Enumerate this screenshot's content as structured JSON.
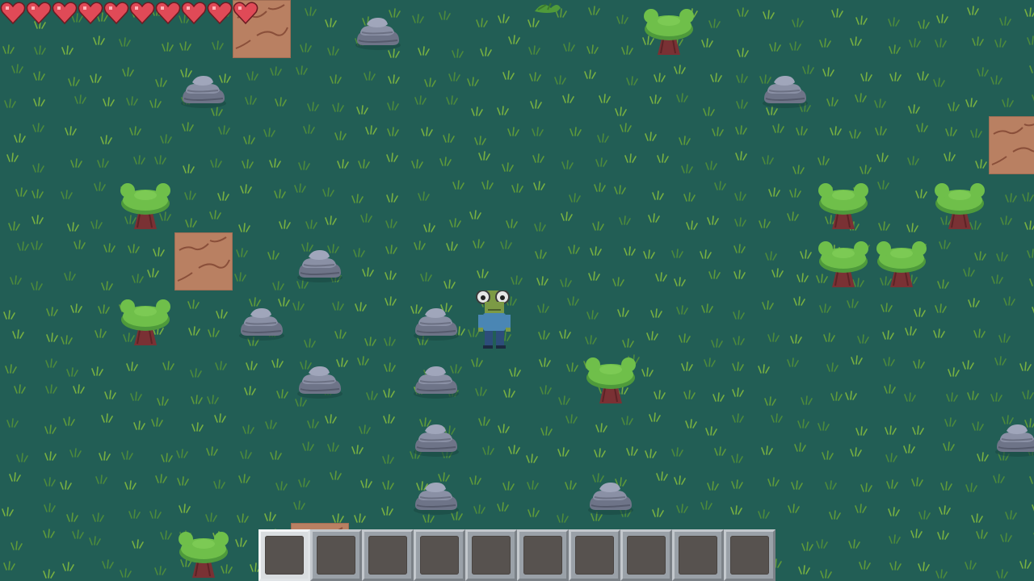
{
  "hud": {
    "health": {
      "current": 10,
      "max": 10
    },
    "hotbar": {
      "slot_count": 10,
      "selected_slot": 0,
      "items": [
        null,
        null,
        null,
        null,
        null,
        null,
        null,
        null,
        null,
        null
      ]
    }
  },
  "world": {
    "tile_size": 72,
    "background_color": "#225e55",
    "grass_blade_colors": [
      "#5f9a3a",
      "#78b041",
      "#4d8a3c"
    ]
  },
  "player": {
    "character": "frog-person",
    "shirt_color": "#4a86b4",
    "pants_color": "#2d4d7a",
    "skin_color": "#7c9a45"
  },
  "objects": {
    "rocks": [
      {
        "col": 6,
        "row": 0
      },
      {
        "col": 3,
        "row": 1
      },
      {
        "col": 13,
        "row": 1
      },
      {
        "col": 5,
        "row": 4
      },
      {
        "col": 4,
        "row": 5
      },
      {
        "col": 7,
        "row": 5
      },
      {
        "col": 5,
        "row": 6
      },
      {
        "col": 7,
        "row": 6
      },
      {
        "col": 7,
        "row": 7
      },
      {
        "col": 7,
        "row": 8
      },
      {
        "col": 10,
        "row": 8
      },
      {
        "col": 17,
        "row": 7
      }
    ],
    "trees": [
      {
        "col": 11,
        "row": 0
      },
      {
        "col": 2,
        "row": 3
      },
      {
        "col": 14,
        "row": 3
      },
      {
        "col": 16,
        "row": 3
      },
      {
        "col": 14,
        "row": 4
      },
      {
        "col": 15,
        "row": 4
      },
      {
        "col": 2,
        "row": 5
      },
      {
        "col": 10,
        "row": 6
      },
      {
        "col": 3,
        "row": 9
      }
    ],
    "dirt_tiles": [
      {
        "col": 4,
        "row": 0
      },
      {
        "col": 17,
        "row": 2
      },
      {
        "col": 3,
        "row": 4
      },
      {
        "col": 5,
        "row": 9
      }
    ],
    "bushes": [
      {
        "col": 9,
        "row": 0
      }
    ],
    "player_tile": {
      "col": 8,
      "row": 5
    }
  }
}
